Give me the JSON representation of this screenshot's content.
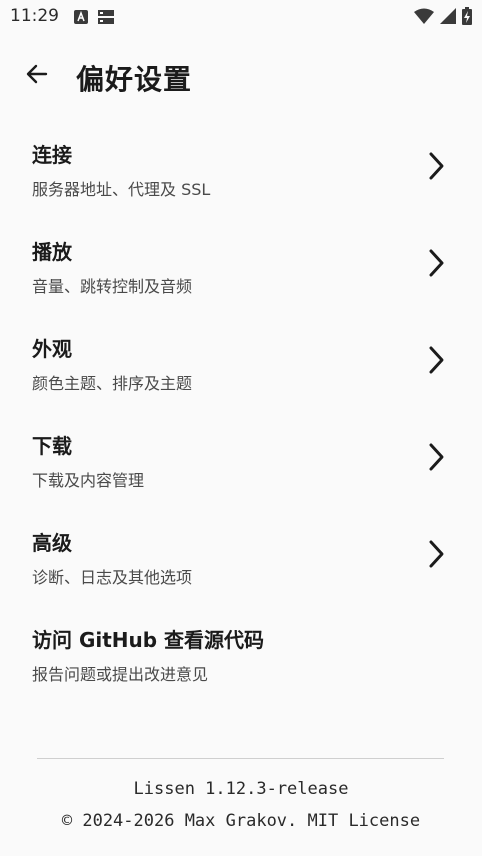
{
  "status_bar": {
    "time": "11:29",
    "left_icons": [
      "text-a-icon",
      "storage-icon"
    ],
    "right_icons": [
      "wifi-icon",
      "signal-icon",
      "battery-charging-icon"
    ]
  },
  "app_bar": {
    "back_icon": "arrow-back-icon",
    "title": "偏好设置"
  },
  "settings": {
    "items": [
      {
        "title": "连接",
        "subtitle": "服务器地址、代理及 SSL",
        "has_chevron": true
      },
      {
        "title": "播放",
        "subtitle": "音量、跳转控制及音频",
        "has_chevron": true
      },
      {
        "title": "外观",
        "subtitle": "颜色主题、排序及主题",
        "has_chevron": true
      },
      {
        "title": "下载",
        "subtitle": "下载及内容管理",
        "has_chevron": true
      },
      {
        "title": "高级",
        "subtitle": "诊断、日志及其他选项",
        "has_chevron": true
      },
      {
        "title": "访问 GitHub 查看源代码",
        "subtitle": "报告问题或提出改进意见",
        "has_chevron": false
      }
    ]
  },
  "footer": {
    "version": "Lissen 1.12.3-release",
    "license": "© 2024-2026 Max Grakov. MIT License"
  }
}
